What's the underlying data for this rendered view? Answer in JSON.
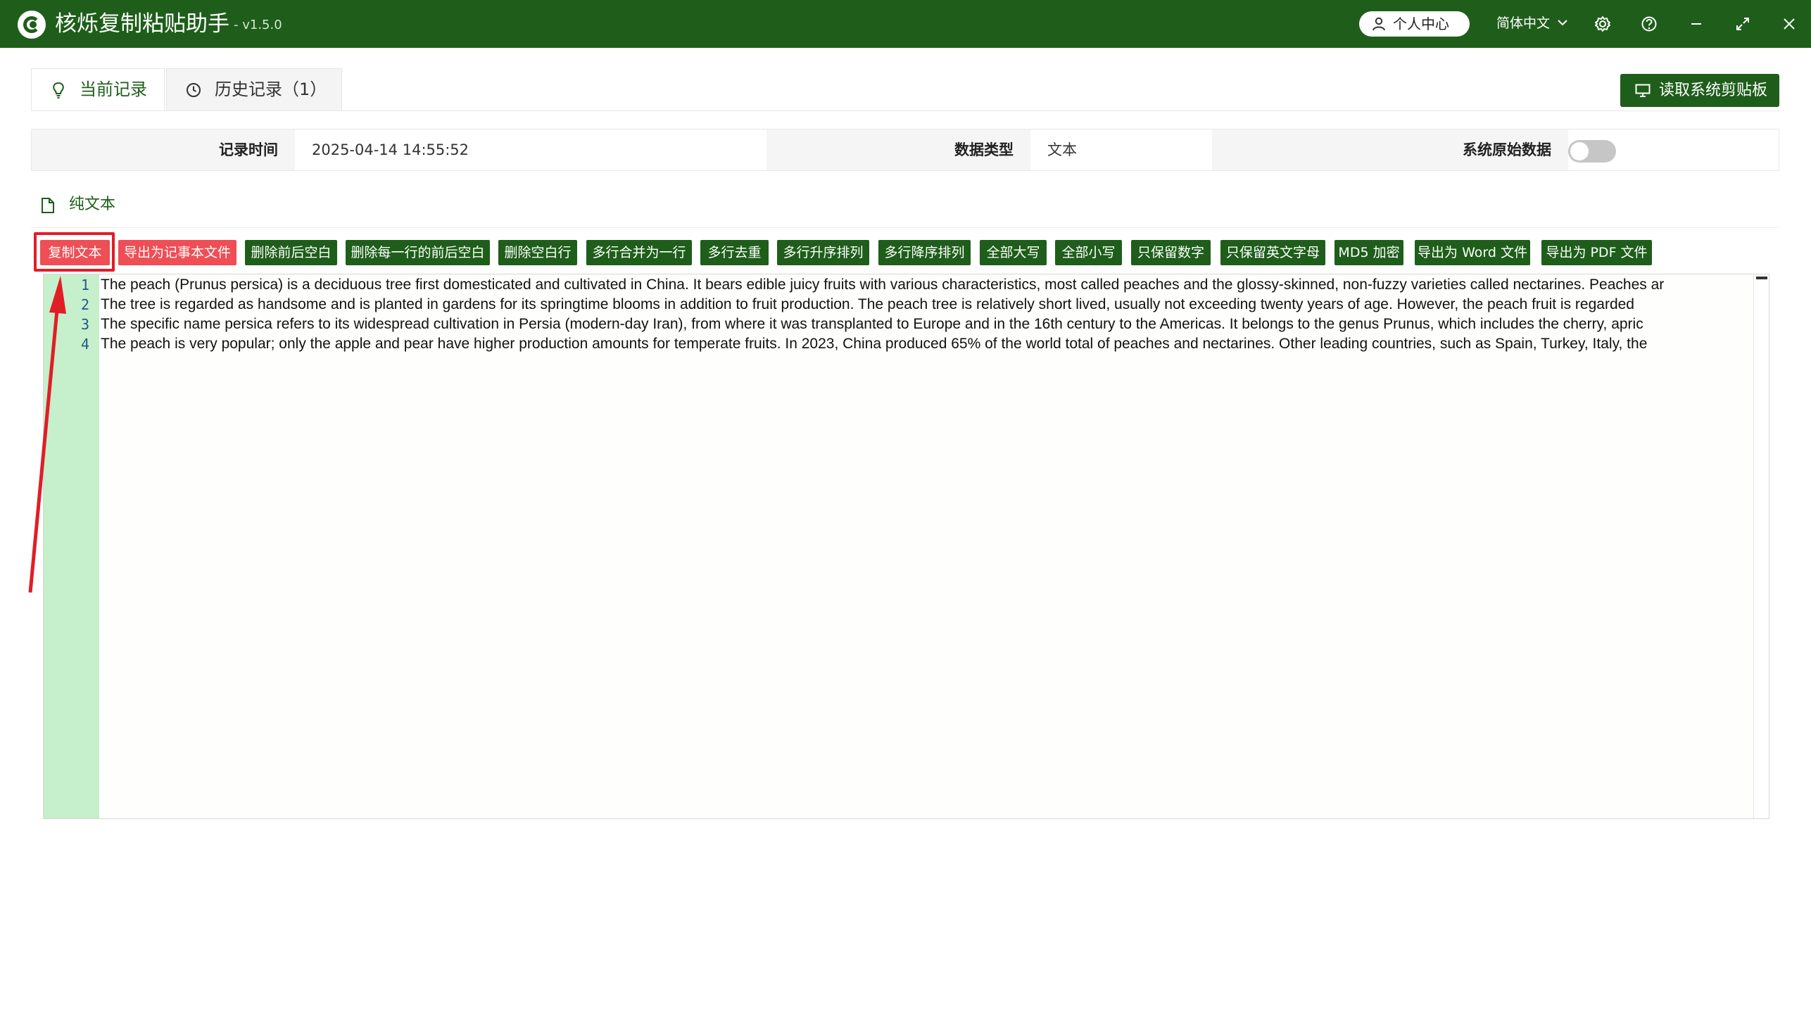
{
  "app": {
    "title": "核烁复制粘贴助手",
    "version": "- v1.5.0",
    "user_center": "个人中心",
    "language": "简体中文"
  },
  "tabs": [
    {
      "label": "当前记录",
      "active": true,
      "icon": "bulb-icon"
    },
    {
      "label": "历史记录（1）",
      "active": false,
      "icon": "clock-icon"
    }
  ],
  "read_clipboard_label": "读取系统剪贴板",
  "info": {
    "time_label": "记录时间",
    "time_value": "2025-04-14 14:55:52",
    "type_label": "数据类型",
    "type_value": "文本",
    "raw_label": "系统原始数据",
    "raw_enabled": false
  },
  "section_title": "纯文本",
  "actions": [
    {
      "label": "复制文本",
      "color": "#ef4e55"
    },
    {
      "label": "导出为记事本文件",
      "color": "#ef4e55"
    },
    {
      "label": "删除前后空白",
      "color": "#1e5e1a"
    },
    {
      "label": "删除每一行的前后空白",
      "color": "#1e5e1a"
    },
    {
      "label": "删除空白行",
      "color": "#1e5e1a"
    },
    {
      "label": "多行合并为一行",
      "color": "#1e5e1a"
    },
    {
      "label": "多行去重",
      "color": "#1e5e1a"
    },
    {
      "label": "多行升序排列",
      "color": "#1e5e1a"
    },
    {
      "label": "多行降序排列",
      "color": "#1e5e1a"
    },
    {
      "label": "全部大写",
      "color": "#1e5e1a"
    },
    {
      "label": "全部小写",
      "color": "#1e5e1a"
    },
    {
      "label": "只保留数字",
      "color": "#1e5e1a"
    },
    {
      "label": "只保留英文字母",
      "color": "#1e5e1a"
    },
    {
      "label": "MD5 加密",
      "color": "#1e5e1a"
    },
    {
      "label": "导出为 Word 文件",
      "color": "#1e5e1a"
    },
    {
      "label": "导出为 PDF 文件",
      "color": "#1e5e1a"
    }
  ],
  "editor": {
    "line_numbers": [
      "1",
      "2",
      "3",
      "4"
    ],
    "lines": [
      "The peach (Prunus persica) is a deciduous tree first domesticated and cultivated in China. It bears edible juicy fruits with various characteristics, most called peaches and the glossy-skinned, non-fuzzy varieties called nectarines. Peaches ar",
      "The tree is regarded as handsome and is planted in gardens for its springtime blooms in addition to fruit production. The peach tree is relatively short lived, usually not exceeding twenty years of age. However, the peach fruit is regarded",
      "The specific name persica refers to its widespread cultivation in Persia (modern-day Iran), from where it was transplanted to Europe and in the 16th century to the Americas. It belongs to the genus Prunus, which includes the cherry, apric",
      "The peach is very popular; only the apple and pear have higher production amounts for temperate fruits. In 2023, China produced 65% of the world total of peaches and nectarines. Other leading countries, such as Spain, Turkey, Italy, the"
    ]
  },
  "colors": {
    "brand_green": "#1e5e1a",
    "accent_red": "#ef4e55",
    "gutter_green": "#c6efcb",
    "annotation_red": "#e01e26"
  }
}
